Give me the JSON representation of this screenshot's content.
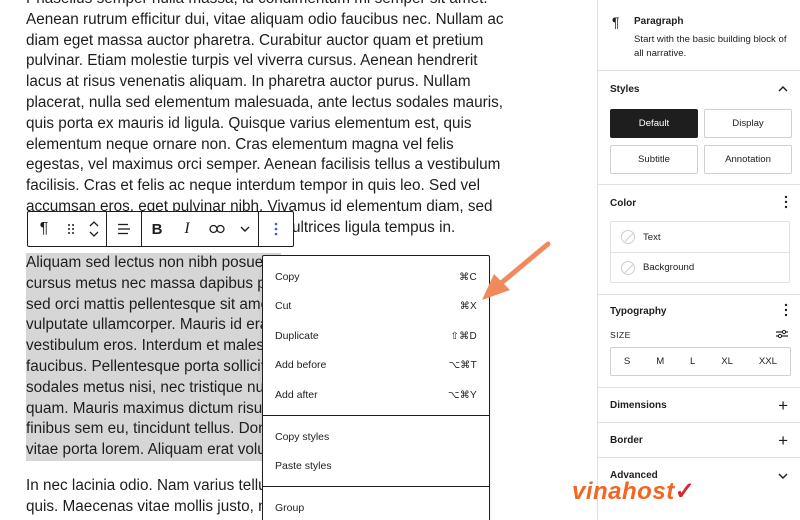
{
  "editor": {
    "paragraph1_lines": [
      "Phasellus semper nulla massa, id condimentum mi semper sit amet.",
      "Aenean rutrum efficitur dui, vitae aliquam odio faucibus nec. Nullam ac",
      "diam eget massa auctor pharetra. Curabitur auctor quam et pretium",
      "pulvinar. Etiam molestie turpis vel viverra cursus. Aenean hendrerit",
      "lacus at risus venenatis aliquam. In pharetra auctor purus. Nullam",
      "placerat, nulla sed elementum malesuada, ante lectus sodales mauris,",
      "quis porta ex mauris id ligula. Quisque varius elementum est, quis",
      "elementum neque ornare non. Cras elementum magna vel felis",
      "egestas, vel maximus orci semper. Aenean facilisis tellus a vestibulum",
      "facilisis. Cras et felis ac neque interdum tempor in quis leo. Sed vel",
      "accumsan eros, eget pulvinar nibh. Vivamus id elementum diam, sed",
      "ultrices ligula tempus in."
    ],
    "paragraph2_lines": [
      "Aliquam sed lectus non nibh posuere",
      "cursus metus nec massa dapibus po",
      "sed orci mattis pellentesque sit ame",
      "vulputate ullamcorper. Mauris id era",
      "vestibulum eros. Interdum et malesu",
      "faucibus. Pellentesque porta sollicit",
      "sodales metus nisi, nec tristique nu",
      "quam. Mauris maximus dictum risus",
      "finibus sem eu, tincidunt tellus. Don",
      "vitae porta lorem. Aliquam erat volut"
    ],
    "paragraph3_lines": [
      "In nec lacinia odio. Nam varius tellus",
      "quis. Maecenas vitae mollis justo, ne"
    ]
  },
  "toolbar": {
    "paragraph_icon": "paragraph-icon",
    "drag_icon": "drag-handle-icon",
    "move_icon": "move-up-down-icon",
    "align_icon": "align-icon",
    "bold_label": "B",
    "italic_label": "I",
    "link_icon": "link-icon",
    "more_rich_icon": "chevron-down-icon",
    "options_icon": "vertical-ellipsis-icon"
  },
  "menu": {
    "items": [
      {
        "label": "Copy",
        "shortcut": "⌘C"
      },
      {
        "label": "Cut",
        "shortcut": "⌘X"
      },
      {
        "label": "Duplicate",
        "shortcut": "⇧⌘D"
      },
      {
        "label": "Add before",
        "shortcut": "⌥⌘T"
      },
      {
        "label": "Add after",
        "shortcut": "⌥⌘Y"
      },
      {
        "label": "Copy styles",
        "shortcut": ""
      },
      {
        "label": "Paste styles",
        "shortcut": ""
      },
      {
        "label": "Group",
        "shortcut": ""
      }
    ]
  },
  "sidebar": {
    "block_card": {
      "title": "Paragraph",
      "description": "Start with the basic building block of all narrative."
    },
    "styles": {
      "heading": "Styles",
      "options": [
        "Default",
        "Display",
        "Subtitle",
        "Annotation"
      ],
      "active": "Default"
    },
    "color": {
      "heading": "Color",
      "items": [
        "Text",
        "Background"
      ]
    },
    "typography": {
      "heading": "Typography",
      "size_label": "SIZE",
      "sizes": [
        "S",
        "M",
        "L",
        "XL",
        "XXL"
      ]
    },
    "dimensions": {
      "heading": "Dimensions"
    },
    "border": {
      "heading": "Border"
    },
    "advanced": {
      "heading": "Advanced"
    }
  },
  "watermark": {
    "text": "vinahost",
    "mark": "✓"
  },
  "colors": {
    "accent_arrow": "#f08a5d",
    "text": "#1e1e1e",
    "selection": "#d6d6d6",
    "active_style": "#1e1e1e"
  }
}
